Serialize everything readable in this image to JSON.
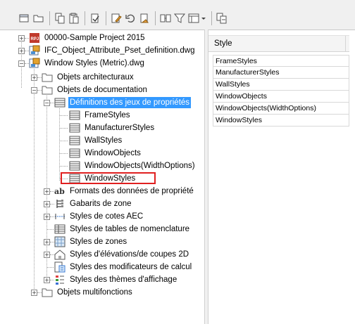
{
  "toolbar": {
    "buttons": [
      {
        "name": "new-icon",
        "glyph": "new"
      },
      {
        "name": "open-icon",
        "glyph": "open"
      },
      {
        "name": "copy-icon",
        "glyph": "copy"
      },
      {
        "name": "paste-icon",
        "glyph": "paste"
      },
      {
        "name": "purge-icon",
        "glyph": "purge"
      },
      {
        "name": "edit-style-icon",
        "glyph": "edit"
      },
      {
        "name": "undo-icon",
        "glyph": "undo"
      },
      {
        "name": "import-icon",
        "glyph": "import"
      },
      {
        "name": "compare-icon",
        "glyph": "compare"
      },
      {
        "name": "filter-icon",
        "glyph": "filter"
      },
      {
        "name": "view-icon",
        "glyph": "view"
      },
      {
        "name": "sync-icon",
        "glyph": "sync"
      }
    ]
  },
  "tree": {
    "root_items": [
      {
        "label": "00000-Sample Project 2015",
        "icon": "project-icon"
      },
      {
        "label": "IFC_Object_Attribute_Pset_definition.dwg",
        "icon": "drawing-icon"
      },
      {
        "label": "Window Styles (Metric).dwg",
        "icon": "drawing-icon"
      }
    ],
    "categories": [
      {
        "label": "Objets architecturaux",
        "icon": "folder-icon"
      },
      {
        "label": "Objets de documentation",
        "icon": "folder-icon"
      }
    ],
    "doc_children": [
      {
        "label": "Définitions des jeux de propriétés",
        "icon": "property-set-icon"
      },
      {
        "label": "Formats des données de propriété",
        "icon": "property-format-icon"
      },
      {
        "label": "Gabarits de zone",
        "icon": "zone-template-icon"
      },
      {
        "label": "Styles de cotes AEC",
        "icon": "dimension-style-icon"
      },
      {
        "label": "Styles de tables de nomenclature",
        "icon": "schedule-table-icon"
      },
      {
        "label": "Styles de zones",
        "icon": "zone-style-icon"
      },
      {
        "label": "Styles d'élévations/de coupes 2D",
        "icon": "section-style-icon"
      },
      {
        "label": "Styles des modificateurs de calcul",
        "icon": "calc-modifier-icon"
      },
      {
        "label": "Styles des thèmes d'affichage",
        "icon": "display-theme-icon"
      }
    ],
    "pset_children": [
      {
        "label": "FrameStyles"
      },
      {
        "label": "ManufacturerStyles"
      },
      {
        "label": "WallStyles"
      },
      {
        "label": "WindowObjects"
      },
      {
        "label": "WindowObjects(WidthOptions)"
      },
      {
        "label": "WindowStyles"
      }
    ],
    "multi": {
      "label": "Objets multifonctions",
      "icon": "folder-icon"
    }
  },
  "list": {
    "header": "Style",
    "rows": [
      "FrameStyles",
      "ManufacturerStyles",
      "WallStyles",
      "WindowObjects",
      "WindowObjects(WidthOptions)",
      "WindowStyles"
    ]
  },
  "colors": {
    "selection": "#3399ff",
    "highlight_border": "#e02020"
  }
}
